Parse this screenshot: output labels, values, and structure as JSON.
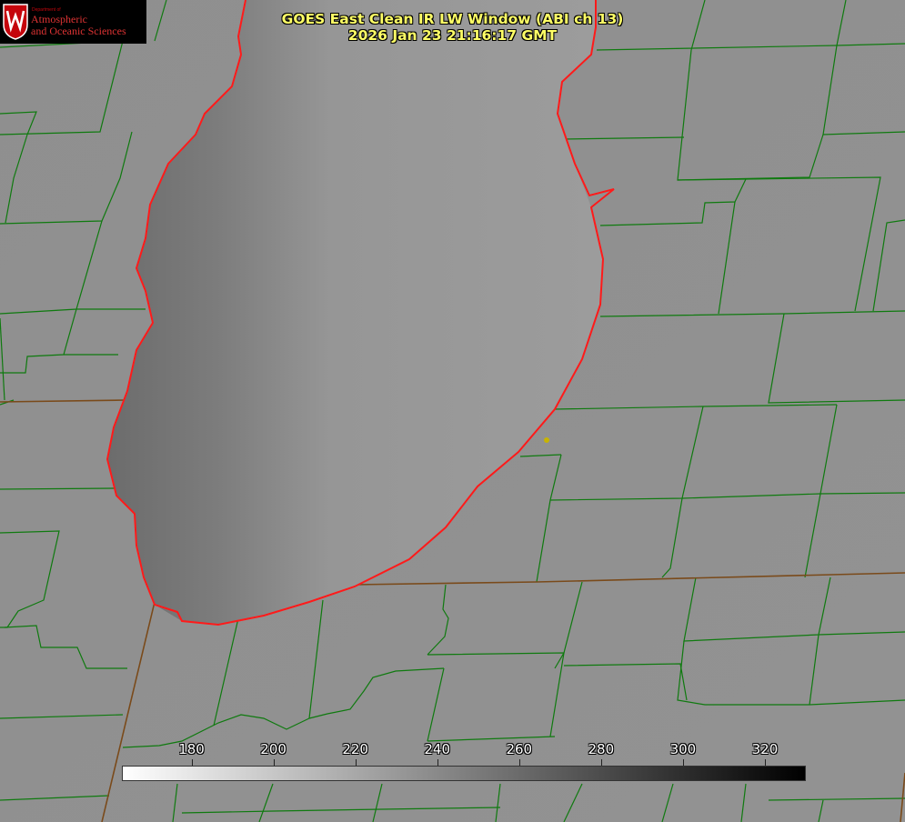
{
  "title": {
    "line1": "GOES East Clean IR LW Window (ABI ch 13)",
    "line2": "2026 Jan 23 21:16:17 GMT"
  },
  "logo": {
    "department": "Department of",
    "name_line1": "Atmospheric",
    "name_line2": "and Oceanic Sciences"
  },
  "colorbar": {
    "ticks": [
      "180",
      "200",
      "220",
      "240",
      "260",
      "280",
      "300",
      "320"
    ],
    "tick_values": [
      180,
      200,
      220,
      240,
      260,
      280,
      300,
      320
    ],
    "min_value": 163,
    "max_value": 330,
    "gradient": [
      "#ffffff",
      "#000000"
    ]
  },
  "colors": {
    "land": "#8a8a8a",
    "lake": "#9a9a9a",
    "county_lines": "#0f7a0f",
    "coastline": "#ff1a1a",
    "title_text": "#ffff66"
  }
}
